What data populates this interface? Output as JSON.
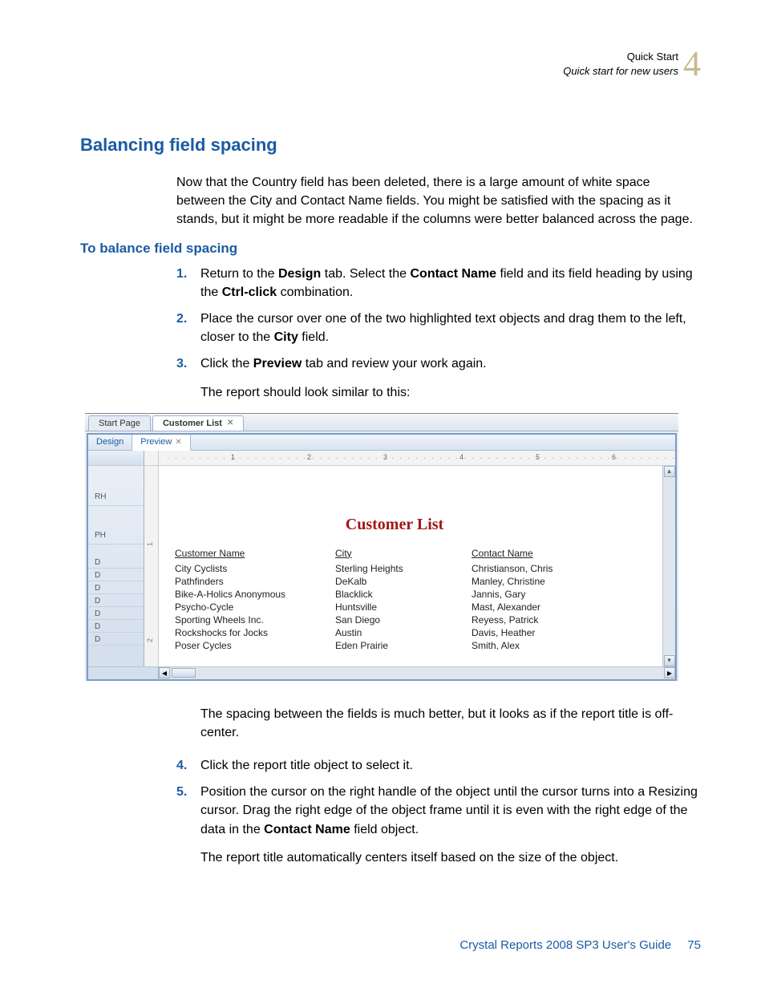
{
  "header": {
    "line1": "Quick Start",
    "line2": "Quick start for new users",
    "chapter_number": "4"
  },
  "section_title": "Balancing field spacing",
  "intro_paragraph": "Now that the Country field has been deleted, there is a large amount of white space between the City and Contact Name fields. You might be satisfied with the spacing as it stands, but it might be more readable if the columns were better balanced across the page.",
  "subheading": "To balance field spacing",
  "steps": [
    {
      "n": "1.",
      "html": "Return to the <b>Design</b> tab. Select the <b>Contact Name</b> field and its field heading by using the <b>Ctrl-click</b> combination."
    },
    {
      "n": "2.",
      "html": "Place the cursor over one of the two highlighted text objects and drag them to the left, closer to the <b>City</b> field."
    },
    {
      "n": "3.",
      "html": "Click the <b>Preview</b> tab and review your work again."
    }
  ],
  "after_step3": "The report should look similar to this:",
  "screenshot": {
    "outer_tabs": {
      "start": "Start Page",
      "active": "Customer List"
    },
    "inner_tabs": {
      "design": "Design",
      "preview": "Preview"
    },
    "ruler_marks": [
      "1",
      "2",
      "3",
      "4",
      "5",
      "6"
    ],
    "section_labels": [
      "RH",
      "PH",
      "D",
      "D",
      "D",
      "D",
      "D",
      "D",
      "D"
    ],
    "vruler_marks": [
      "1",
      "2"
    ],
    "report_title": "Customer List",
    "columns": [
      "Customer Name",
      "City",
      "Contact Name"
    ],
    "rows": [
      [
        "City Cyclists",
        "Sterling Heights",
        "Christianson, Chris"
      ],
      [
        "Pathfinders",
        "DeKalb",
        "Manley, Christine"
      ],
      [
        "Bike-A-Holics Anonymous",
        "Blacklick",
        "Jannis, Gary"
      ],
      [
        "Psycho-Cycle",
        "Huntsville",
        "Mast, Alexander"
      ],
      [
        "Sporting Wheels Inc.",
        "San Diego",
        "Reyess, Patrick"
      ],
      [
        "Rockshocks for Jocks",
        "Austin",
        "Davis, Heather"
      ],
      [
        "Poser Cycles",
        "Eden Prairie",
        "Smith, Alex"
      ]
    ]
  },
  "post_para": "The spacing between the fields is much better, but it looks as if the report title is off-center.",
  "steps2": [
    {
      "n": "4.",
      "html": "Click the report title object to select it."
    },
    {
      "n": "5.",
      "html": "Position the cursor on the right handle of the object until the cursor turns into a Resizing cursor. Drag the right edge of the object frame until it is even with the right edge of the data in the <b>Contact Name</b> field object."
    }
  ],
  "post_para2": "The report title automatically centers itself based on the size of the object.",
  "footer": {
    "doc": "Crystal Reports 2008 SP3 User's Guide",
    "page": "75"
  }
}
